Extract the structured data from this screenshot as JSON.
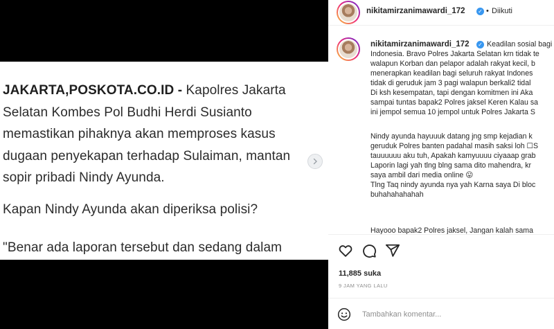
{
  "article": {
    "para1_source": "JAKARTA,POSKOTA.CO.ID -",
    "para1_lines": [
      " Kapolres Jakarta",
      "Selatan Kombes Pol Budhi Herdi Susianto",
      "memastikan pihaknya akan memproses kasus",
      "dugaan penyekapan terhadap Sulaiman, mantan",
      "sopir pribadi Nindy Ayunda."
    ],
    "para2": "Kapan Nindy Ayunda akan diperiksa polisi?",
    "para3": "\"Benar ada laporan tersebut dan sedang dalam"
  },
  "header": {
    "username": "nikitamirzanimawardi_172",
    "separator": "•",
    "follow_status": "Diikuti"
  },
  "caption": {
    "username": "nikitamirzanimawardi_172",
    "first_line": "Keadilan sosial bagi",
    "lines": [
      "Indonesia. Bravo Polres Jakarta Selatan krn tidak te",
      "walapun Korban dan pelapor adalah rakyat kecil, b",
      "menerapkan keadilan bagi seluruh rakyat Indones",
      "tidak di geruduk jam 3 pagi walapun berkali2 tidal",
      "Di ksh kesempatan, tapi dengan komitmen ini Aka",
      "sampai tuntas bapak2 Polres jaksel Keren Kalau sa",
      "ini jempol semua 10 jempol untuk Polres Jakarta S",
      "",
      "Nindy ayunda hayuuuk datang jng smp kejadian k",
      "geruduk Polres banten padahal masih saksi loh ☐S",
      "tauuuuuu aku tuh, Apakah kamyuuuu ciyaaap grab",
      "Laporin lagi yah tlng blng sama dito mahendra, kr",
      "saya ambil dari media online 😛",
      "Tlng Taq nindy ayunda nya yah Karna saya Di bloc",
      "buhahahahahah",
      "",
      "Hayooo bapak2 Polres jaksel, Jangan kalah sama"
    ]
  },
  "actions": {
    "like_icon": "heart-icon",
    "comment_icon": "comment-icon",
    "share_icon": "share-icon",
    "likes": "11,885 suka",
    "timestamp": "9 JAM YANG LALU"
  },
  "comment_box": {
    "emoji_icon": "emoji-icon",
    "placeholder": "Tambahkan komentar..."
  },
  "colors": {
    "verified": "#3897f0",
    "media_background": "#000000",
    "secondary_text": "#8e8e8e"
  }
}
